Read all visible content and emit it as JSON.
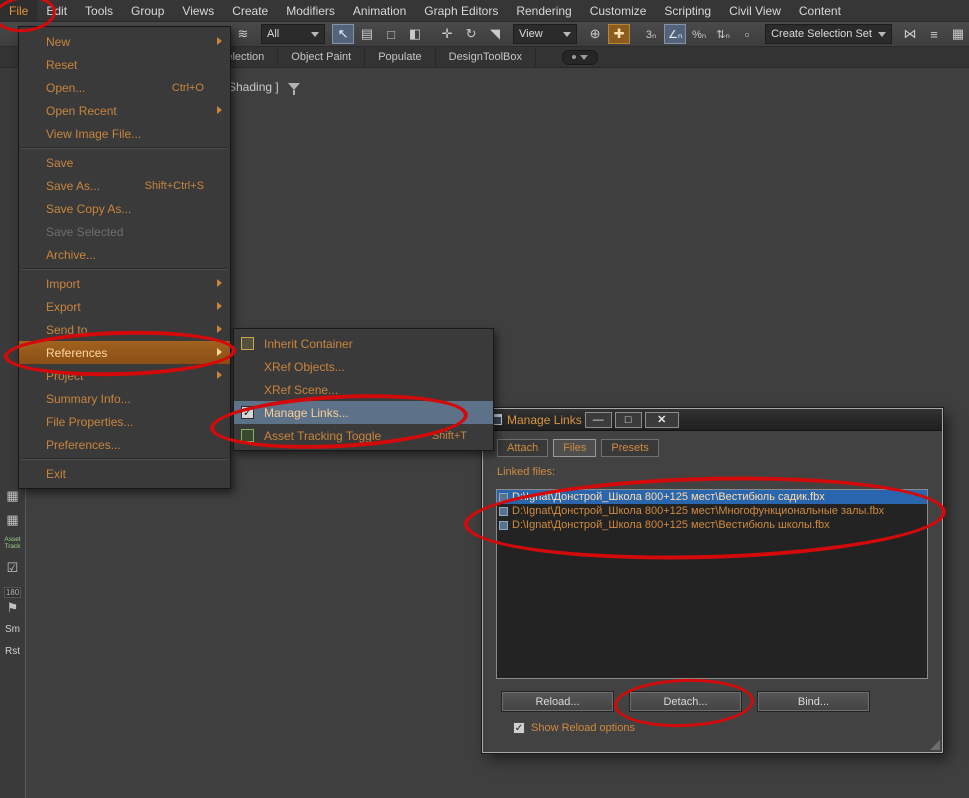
{
  "menubar": {
    "items": [
      "File",
      "Edit",
      "Tools",
      "Group",
      "Views",
      "Create",
      "Modifiers",
      "Animation",
      "Graph Editors",
      "Rendering",
      "Customize",
      "Scripting",
      "Civil View",
      "Content"
    ]
  },
  "toolbar": {
    "filter_combo": "All",
    "coord_combo": "View",
    "selset_combo": "Create Selection Set",
    "icons": [
      {
        "name": "scene-layers-icon",
        "g": "≋"
      },
      {
        "name": "select-object-icon",
        "g": "↖"
      },
      {
        "name": "select-by-name-icon",
        "g": "▤"
      },
      {
        "name": "region-select-icon",
        "g": "□"
      },
      {
        "name": "window-crossing-icon",
        "g": "◧"
      },
      {
        "name": "select-and-move-icon",
        "g": "✛"
      },
      {
        "name": "select-and-rotate-icon",
        "g": "↻"
      },
      {
        "name": "select-and-scale-icon",
        "g": "◥"
      },
      {
        "name": "use-center-icon",
        "g": "⊕"
      },
      {
        "name": "select-and-manipulate-icon",
        "g": "✚"
      },
      {
        "name": "snap-toggle-icon",
        "g": "3ₙ"
      },
      {
        "name": "angle-snap-icon",
        "g": "∠ₙ"
      },
      {
        "name": "percent-snap-icon",
        "g": "%ₙ"
      },
      {
        "name": "spinner-snap-icon",
        "g": "⇅ₙ"
      },
      {
        "name": "named-selection-sets-icon",
        "g": "▫"
      },
      {
        "name": "mirror-icon",
        "g": "⋈"
      },
      {
        "name": "align-icon",
        "g": "≡"
      },
      {
        "name": "layer-manager-icon",
        "g": "▦"
      }
    ]
  },
  "ribbon": {
    "tabs": [
      "Selection",
      "Object Paint",
      "Populate",
      "DesignToolBox"
    ]
  },
  "viewport": {
    "label": "Shading ]"
  },
  "side_strip": {
    "items": [
      {
        "g": "▦"
      },
      {
        "g": "▦"
      },
      {
        "label": "Asset Track"
      },
      {
        "g": "☑"
      },
      {
        "label": "180"
      },
      {
        "g": "⚑"
      },
      {
        "label": "Sm"
      },
      {
        "label": "Rst"
      }
    ]
  },
  "file_menu": {
    "items": [
      {
        "label": "New"
      },
      {
        "label": "Reset"
      },
      {
        "label": "Open...",
        "shortcut": "Ctrl+O"
      },
      {
        "label": "Open Recent"
      },
      {
        "label": "View Image File..."
      },
      {
        "label": "Save"
      },
      {
        "label": "Save As...",
        "shortcut": "Shift+Ctrl+S"
      },
      {
        "label": "Save Copy As..."
      },
      {
        "label": "Save Selected"
      },
      {
        "label": "Archive..."
      },
      {
        "label": "Import"
      },
      {
        "label": "Export"
      },
      {
        "label": "Send to"
      },
      {
        "label": "References"
      },
      {
        "label": "Project"
      },
      {
        "label": "Summary Info..."
      },
      {
        "label": "File Properties..."
      },
      {
        "label": "Preferences..."
      },
      {
        "label": "Exit"
      }
    ]
  },
  "references_submenu": {
    "items": [
      {
        "label": "Inherit Container"
      },
      {
        "label": "XRef Objects..."
      },
      {
        "label": "XRef Scene..."
      },
      {
        "label": "Manage Links..."
      },
      {
        "label": "Asset Tracking Toggle",
        "shortcut": "Shift+T"
      }
    ]
  },
  "dialog": {
    "title": "Manage Links",
    "window_buttons": [
      "—",
      "□",
      "✕"
    ],
    "tabs": [
      "Attach",
      "Files",
      "Presets"
    ],
    "selected_tab": "Files",
    "linked_files_label": "Linked files:",
    "files": [
      {
        "path": "D:\\Ignat\\Донстрой_Школа 800+125 мест\\Вестибюль садик.fbx",
        "selected": true
      },
      {
        "path": "D:\\Ignat\\Донстрой_Школа 800+125 мест\\Многофункциональные залы.fbx",
        "selected": false
      },
      {
        "path": "D:\\Ignat\\Донстрой_Школа 800+125 мест\\Вестибюль школы.fbx",
        "selected": false
      }
    ],
    "buttons": [
      "Reload...",
      "Detach...",
      "Bind..."
    ],
    "checkbox_label": "Show Reload options",
    "checkbox_checked": true
  },
  "icons": {
    "check": "✓"
  },
  "colors": {
    "accent_orange": "#cf8a3e",
    "selection_blue": "#2a66ad",
    "menu_highlight_orange": "#96551a",
    "submenu_highlight_gray": "#5d7189",
    "annotation_red": "#d40a0a",
    "background": "#3f3f3f"
  }
}
